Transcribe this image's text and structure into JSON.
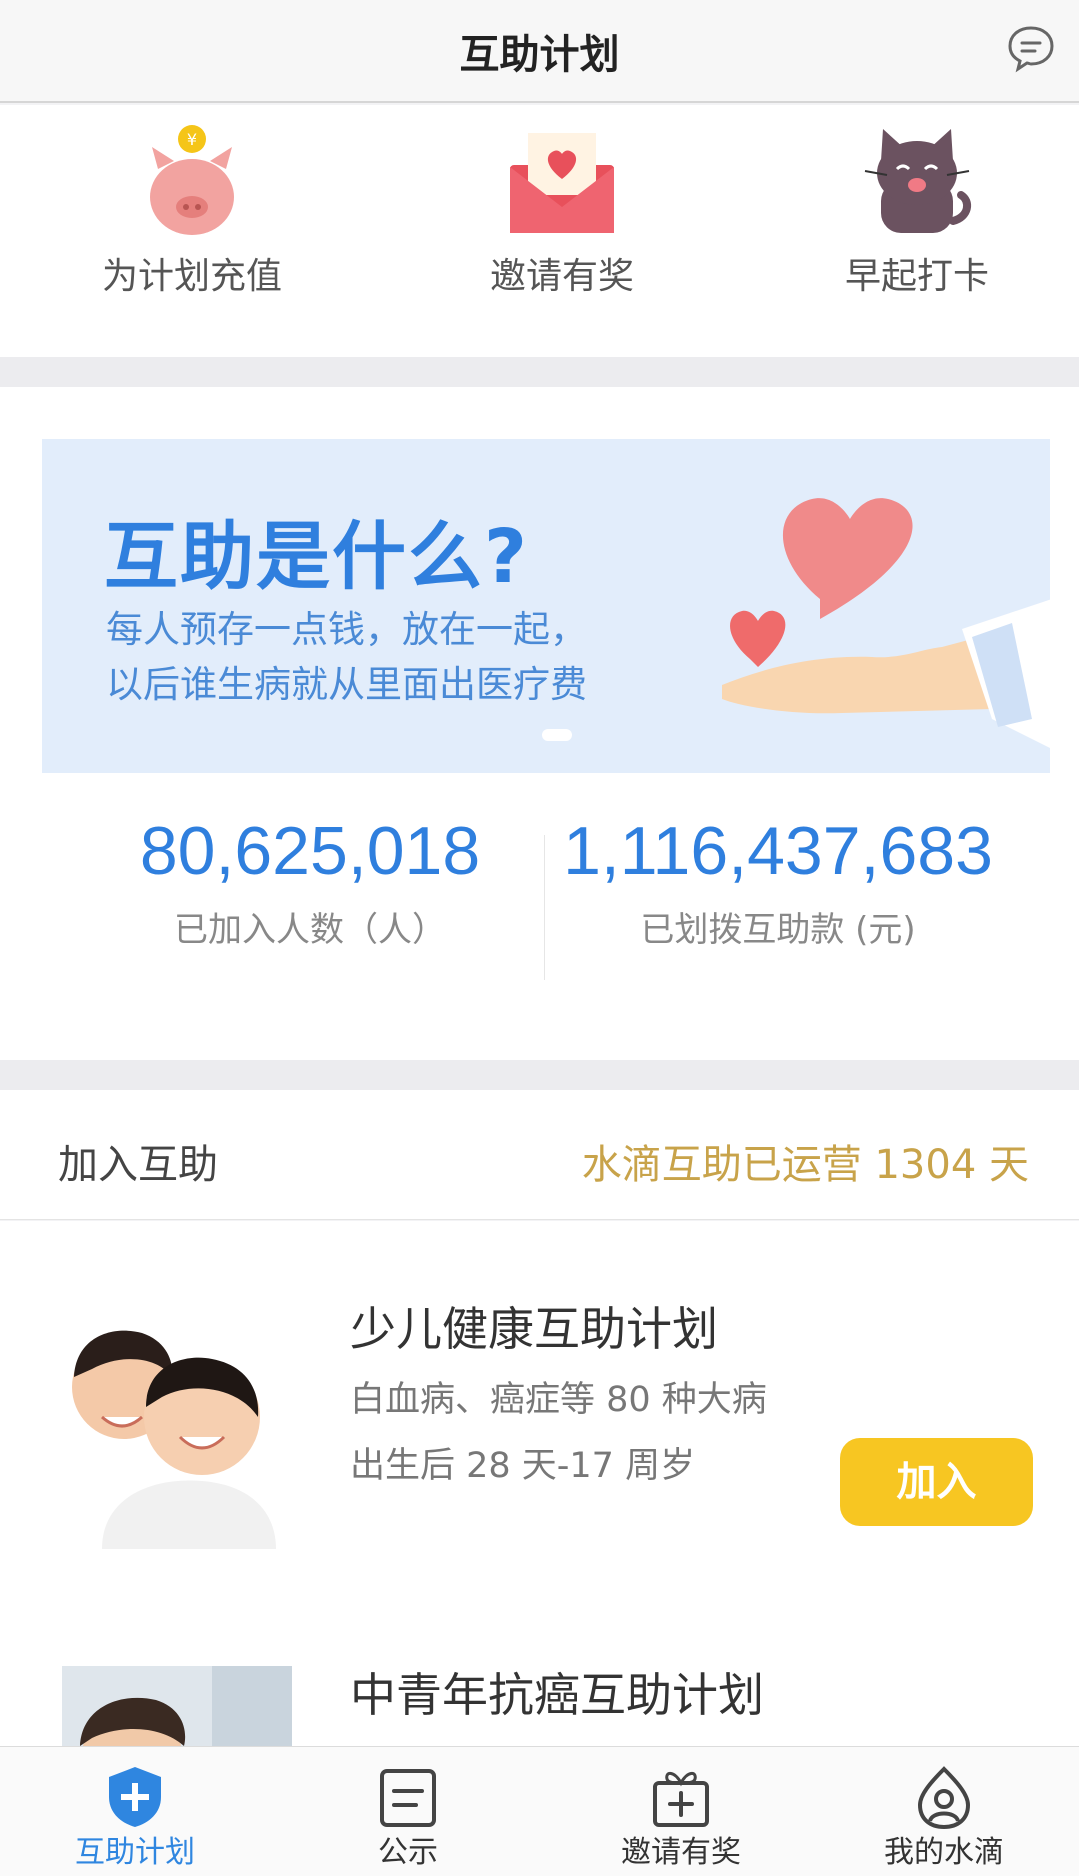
{
  "header": {
    "title": "互助计划",
    "message_icon": "chat-bubble-icon"
  },
  "quick_actions": [
    {
      "label": "为计划充值",
      "icon": "piggy-bank-icon"
    },
    {
      "label": "邀请有奖",
      "icon": "envelope-heart-icon"
    },
    {
      "label": "早起打卡",
      "icon": "cat-icon"
    }
  ],
  "banner": {
    "title": "互助是什么?",
    "line1": "每人预存一点钱，放在一起，",
    "line2": "以后谁生病就从里面出医疗费"
  },
  "stats": {
    "members": {
      "value": "80,625,018",
      "label": "已加入人数（人）"
    },
    "paid": {
      "value": "1,116,437,683",
      "label": "已划拨互助款 (元)"
    }
  },
  "join_section": {
    "title": "加入互助",
    "days_text": "水滴互助已运营 1304 天"
  },
  "plans": [
    {
      "title": "少儿健康互助计划",
      "coverage": "白血病、癌症等 80 种大病",
      "age": "出生后 28 天-17 周岁",
      "button": "加入"
    },
    {
      "title": "中青年抗癌互助计划"
    }
  ],
  "tabbar": [
    {
      "label": "互助计划",
      "icon": "shield-plus-icon",
      "active": true
    },
    {
      "label": "公示",
      "icon": "notice-board-icon",
      "active": false
    },
    {
      "label": "邀请有奖",
      "icon": "gift-box-icon",
      "active": false
    },
    {
      "label": "我的水滴",
      "icon": "profile-drop-icon",
      "active": false
    }
  ],
  "colors": {
    "accent": "#2f7fde",
    "gold": "#c8a34a",
    "button": "#f7c622"
  }
}
